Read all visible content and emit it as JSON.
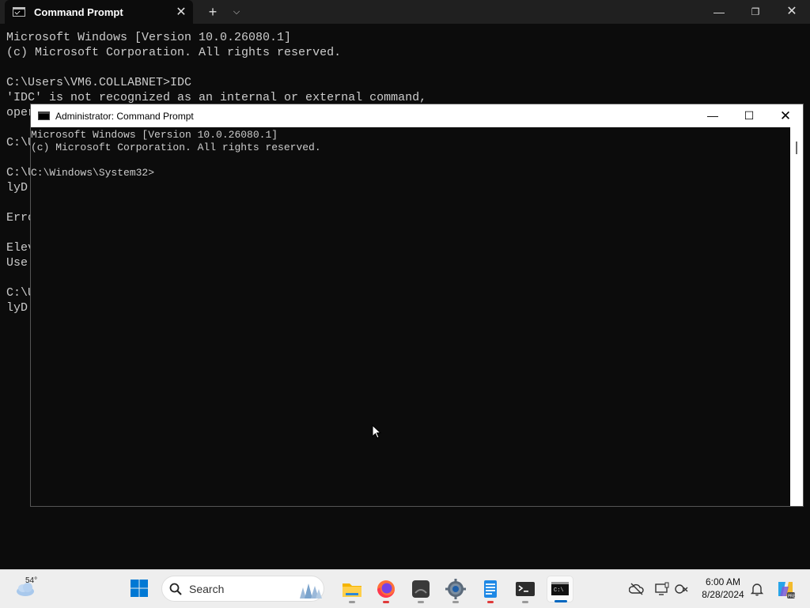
{
  "background_window": {
    "tab_title": "Command Prompt",
    "new_tab_label": "+",
    "dropdown_label": "⌄",
    "console_lines": [
      "Microsoft Windows [Version 10.0.26080.1]",
      "(c) Microsoft Corporation. All rights reserved.",
      "",
      "C:\\Users\\VM6.COLLABNET>IDC",
      "'IDC' is not recognized as an internal or external command,",
      "oper",
      "",
      "C:\\U",
      "",
      "C:\\U",
      "lyD:",
      "",
      "Erro",
      "",
      "Elev",
      "Use ",
      "",
      "C:\\U",
      "lyD:"
    ]
  },
  "admin_window": {
    "title": "Administrator: Command Prompt",
    "console_lines": [
      "Microsoft Windows [Version 10.0.26080.1]",
      "(c) Microsoft Corporation. All rights reserved.",
      "",
      "C:\\Windows\\System32>"
    ]
  },
  "taskbar": {
    "weather_temp": "54°",
    "search_placeholder": "Search",
    "apps": [
      {
        "name": "file-explorer",
        "icon": "folder-icon"
      },
      {
        "name": "firefox",
        "icon": "firefox-icon"
      },
      {
        "name": "media-app",
        "icon": "media-icon"
      },
      {
        "name": "settings",
        "icon": "gear-icon"
      },
      {
        "name": "notepad",
        "icon": "notepad-icon"
      },
      {
        "name": "terminal",
        "icon": "terminal-icon"
      },
      {
        "name": "command-prompt",
        "icon": "cmd-icon"
      }
    ],
    "clock_time": "6:00 AM",
    "clock_date": "8/28/2024"
  },
  "colors": {
    "console_bg": "#0c0c0c",
    "console_text": "#cccccc",
    "taskbar_bg": "#eeeeee",
    "accent": "#0067c0"
  }
}
